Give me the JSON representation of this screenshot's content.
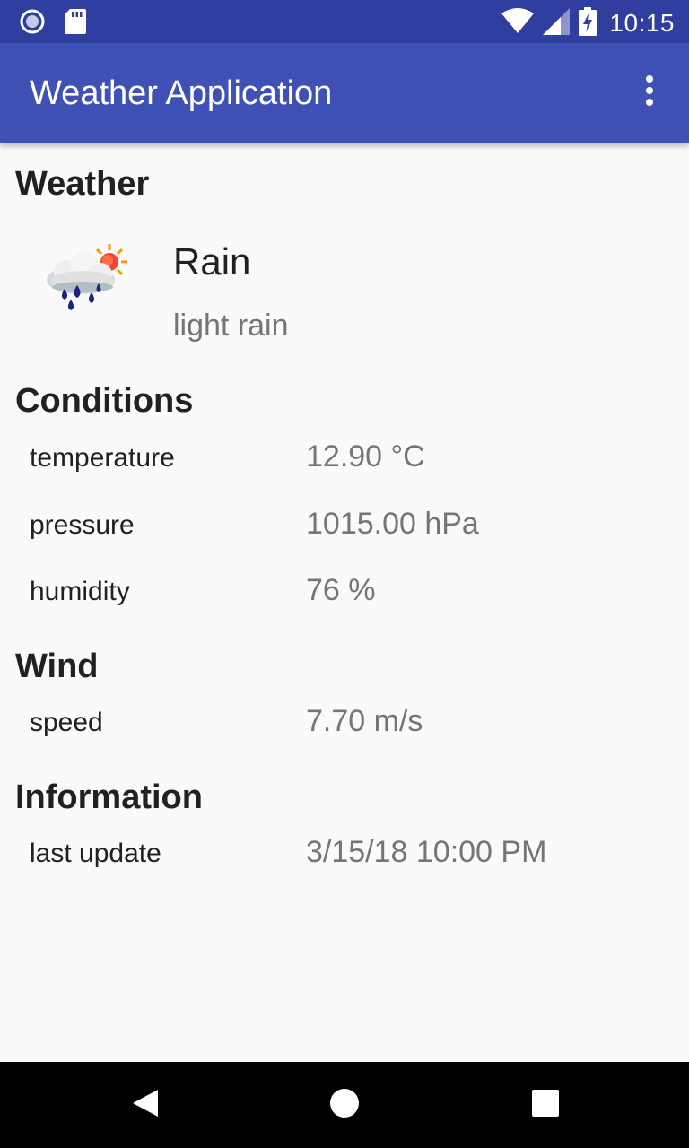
{
  "status_bar": {
    "time": "10:15",
    "icons": [
      "record-icon",
      "sd-card-icon",
      "wifi-icon",
      "signal-icon",
      "battery-charging-icon"
    ]
  },
  "app_bar": {
    "title": "Weather Application",
    "menu_icon": "more-vert-icon"
  },
  "weather": {
    "heading": "Weather",
    "icon": "rain-sun-cloud-icon",
    "main": "Rain",
    "description": "light rain"
  },
  "conditions": {
    "heading": "Conditions",
    "rows": [
      {
        "label": "temperature",
        "value": "12.90 °C"
      },
      {
        "label": "pressure",
        "value": "1015.00 hPa"
      },
      {
        "label": "humidity",
        "value": "76 %"
      }
    ]
  },
  "wind": {
    "heading": "Wind",
    "rows": [
      {
        "label": "speed",
        "value": "7.70 m/s"
      }
    ]
  },
  "information": {
    "heading": "Information",
    "rows": [
      {
        "label": "last update",
        "value": "3/15/18 10:00 PM"
      }
    ]
  },
  "nav_bar": {
    "icons": [
      "back-icon",
      "home-icon",
      "recents-icon"
    ]
  },
  "colors": {
    "status_bar": "#303f9f",
    "app_bar": "#3f51b5",
    "background": "#fafafa",
    "secondary_text": "#757575"
  }
}
